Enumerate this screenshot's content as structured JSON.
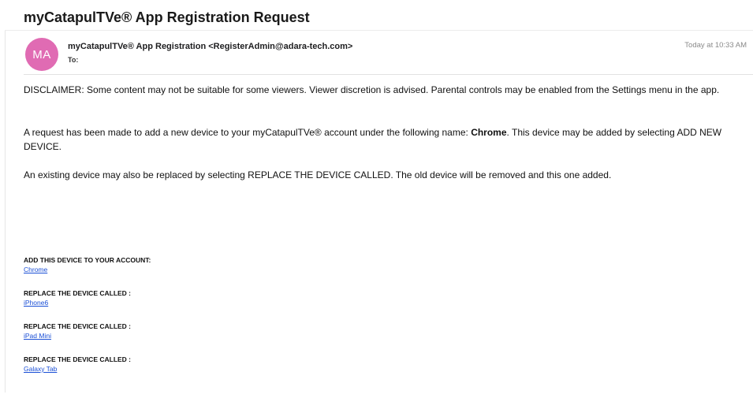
{
  "email": {
    "subject": "myCatapulTVe® App Registration Request",
    "avatar_initials": "MA",
    "avatar_color": "#e06bb3",
    "sender": "myCatapulTVe® App Registration <RegisterAdmin@adara-tech.com>",
    "to_label": "To:",
    "timestamp": "Today at 10:33 AM"
  },
  "body": {
    "disclaimer": "DISCLAIMER: Some content may not be suitable for some viewers. Viewer discretion is advised. Parental controls may be enabled from the Settings menu in the app.",
    "request_pre": "A request has been made to add a new device to your myCatapulTVe® account under the following name: ",
    "request_device": "Chrome",
    "request_post": ". This device may be added by selecting ADD NEW DEVICE.",
    "replace_note": "An existing device may also be replaced by selecting REPLACE THE DEVICE CALLED. The old device will be removed and this one added."
  },
  "actions": [
    {
      "label": "ADD THIS DEVICE TO YOUR ACCOUNT:",
      "link": "Chrome"
    },
    {
      "label": "REPLACE THE DEVICE CALLED :",
      "link": "iPhone6"
    },
    {
      "label": "REPLACE THE DEVICE CALLED :",
      "link": "iPad Mini"
    },
    {
      "label": "REPLACE THE DEVICE CALLED :",
      "link": "Galaxy Tab"
    }
  ],
  "link_color": "#1a4fd6"
}
